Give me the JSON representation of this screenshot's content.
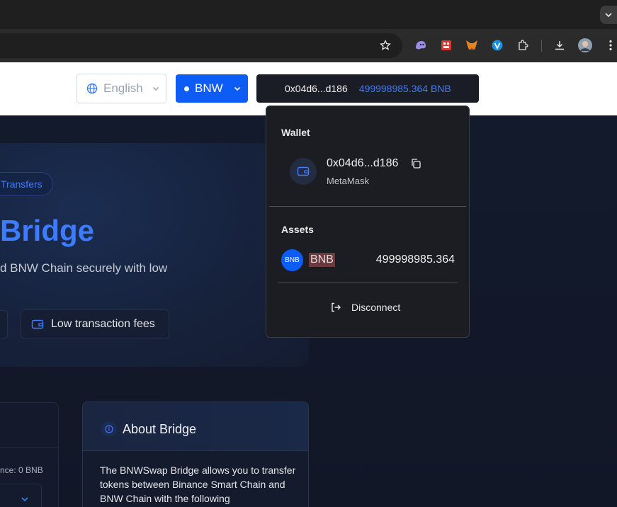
{
  "app_header": {
    "language": {
      "label": "English",
      "icon": "globe-icon"
    },
    "chain": {
      "label": "BNW"
    },
    "wallet": {
      "address": "0x04d6...d186",
      "balance": "499998985.364 BNB"
    }
  },
  "hero": {
    "pill": "Transfers",
    "title": "Bridge",
    "subtitle": "d BNW Chain securely with low",
    "feature": "Low transaction fees"
  },
  "swap_card": {
    "balance_text": "nce: 0 BNB"
  },
  "about": {
    "title": "About Bridge",
    "body": "The BNWSwap Bridge allows you to transfer tokens between Binance Smart Chain and BNW Chain with the following"
  },
  "wallet_dropdown": {
    "wallet_label": "Wallet",
    "address": "0x04d6...d186",
    "provider": "MetaMask",
    "assets_label": "Assets",
    "asset": {
      "icon_text": "BNB",
      "symbol": "BNB",
      "amount": "499998985.364"
    },
    "disconnect": "Disconnect"
  },
  "colors": {
    "accent": "#0e5cf6",
    "link": "#3d7bff",
    "dropdown_bg": "#1b1d22"
  }
}
